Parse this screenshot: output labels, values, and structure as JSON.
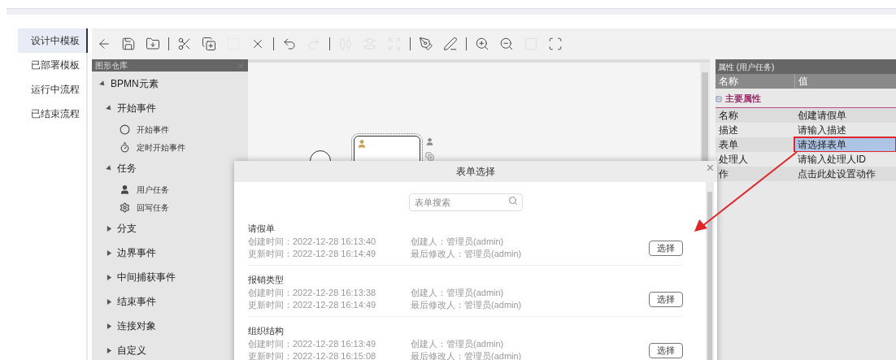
{
  "nav": [
    {
      "label": "设计中模板",
      "selected": true
    },
    {
      "label": "已部署模板",
      "selected": false
    },
    {
      "label": "运行中流程",
      "selected": false
    },
    {
      "label": "已结束流程",
      "selected": false
    }
  ],
  "toolbar": [
    {
      "buttons": [
        {
          "kind": "back",
          "disabled": false
        },
        {
          "kind": "save",
          "disabled": false
        },
        {
          "kind": "import",
          "disabled": false
        }
      ]
    },
    {
      "buttons": [
        {
          "kind": "cut",
          "disabled": false
        },
        {
          "kind": "copy",
          "disabled": false
        },
        {
          "kind": "paste",
          "disabled": true
        },
        {
          "kind": "delete",
          "disabled": false
        }
      ]
    },
    {
      "buttons": [
        {
          "kind": "undo",
          "disabled": false
        },
        {
          "kind": "redo",
          "disabled": true
        }
      ]
    },
    {
      "buttons": [
        {
          "kind": "alignv",
          "disabled": true
        },
        {
          "kind": "alignh",
          "disabled": true
        },
        {
          "kind": "expand",
          "disabled": true
        }
      ]
    },
    {
      "buttons": [
        {
          "kind": "penadd",
          "disabled": false
        },
        {
          "kind": "penremove",
          "disabled": false
        }
      ]
    },
    {
      "buttons": [
        {
          "kind": "zoomin",
          "disabled": false
        },
        {
          "kind": "zoomout",
          "disabled": false
        },
        {
          "kind": "actual",
          "disabled": true
        },
        {
          "kind": "fit",
          "disabled": false
        }
      ]
    }
  ],
  "palette": {
    "title": "图形仓库",
    "items": [
      {
        "label": "BPMN元素",
        "expanded": true,
        "children": [
          {
            "label": "开始事件",
            "expanded": true,
            "children": [
              {
                "label": "开始事件",
                "kind": "start"
              },
              {
                "label": "定时开始事件",
                "kind": "timer"
              }
            ]
          },
          {
            "label": "任务",
            "expanded": true,
            "children": [
              {
                "label": "用户任务",
                "kind": "user"
              },
              {
                "label": "回写任务",
                "kind": "gear"
              }
            ]
          },
          {
            "label": "分支",
            "expanded": false
          },
          {
            "label": "边界事件",
            "expanded": false
          },
          {
            "label": "中间捕获事件",
            "expanded": false
          },
          {
            "label": "结束事件",
            "expanded": false
          },
          {
            "label": "连接对象",
            "expanded": false
          },
          {
            "label": "自定义",
            "expanded": false
          }
        ]
      }
    ]
  },
  "properties": {
    "title": "属性 (用户任务)",
    "columns": [
      "名称",
      "值"
    ],
    "section": "主要属性",
    "rows": [
      {
        "name": "名称",
        "value": "创建请假单",
        "selected": false
      },
      {
        "name": "描述",
        "value": "请输入描述",
        "selected": false
      },
      {
        "name": "表单",
        "value": "请选择表单",
        "selected": true
      },
      {
        "name": "处理人",
        "value": "请输入处理人ID",
        "selected": false
      },
      {
        "name": "作",
        "value": "点击此处设置动作",
        "selected": false
      }
    ]
  },
  "dialog": {
    "title": "表单选择",
    "close": "×",
    "search": {
      "placeholder": "表单搜索"
    },
    "forms": [
      {
        "name": "请假单",
        "created": "创建时间：2022-12-28 16:13:40",
        "updated": "更新时间：2022-12-28 16:14:49",
        "creator": "创建人：管理员(admin)",
        "modifier": "最后修改人：管理员(admin)",
        "button": "选择"
      },
      {
        "name": "报销类型",
        "created": "创建时间：2022-12-28 16:13:38",
        "updated": "更新时间：2022-12-28 16:14:49",
        "creator": "创建人：管理员(admin)",
        "modifier": "最后修改人：管理员(admin)",
        "button": "选择"
      },
      {
        "name": "组织结构",
        "created": "创建时间：2022-12-28 16:13:49",
        "updated": "更新时间：2022-12-28 16:15:08",
        "creator": "创建人：管理员(admin)",
        "modifier": "最后修改人：管理员(admin)",
        "button": "选择"
      }
    ]
  }
}
